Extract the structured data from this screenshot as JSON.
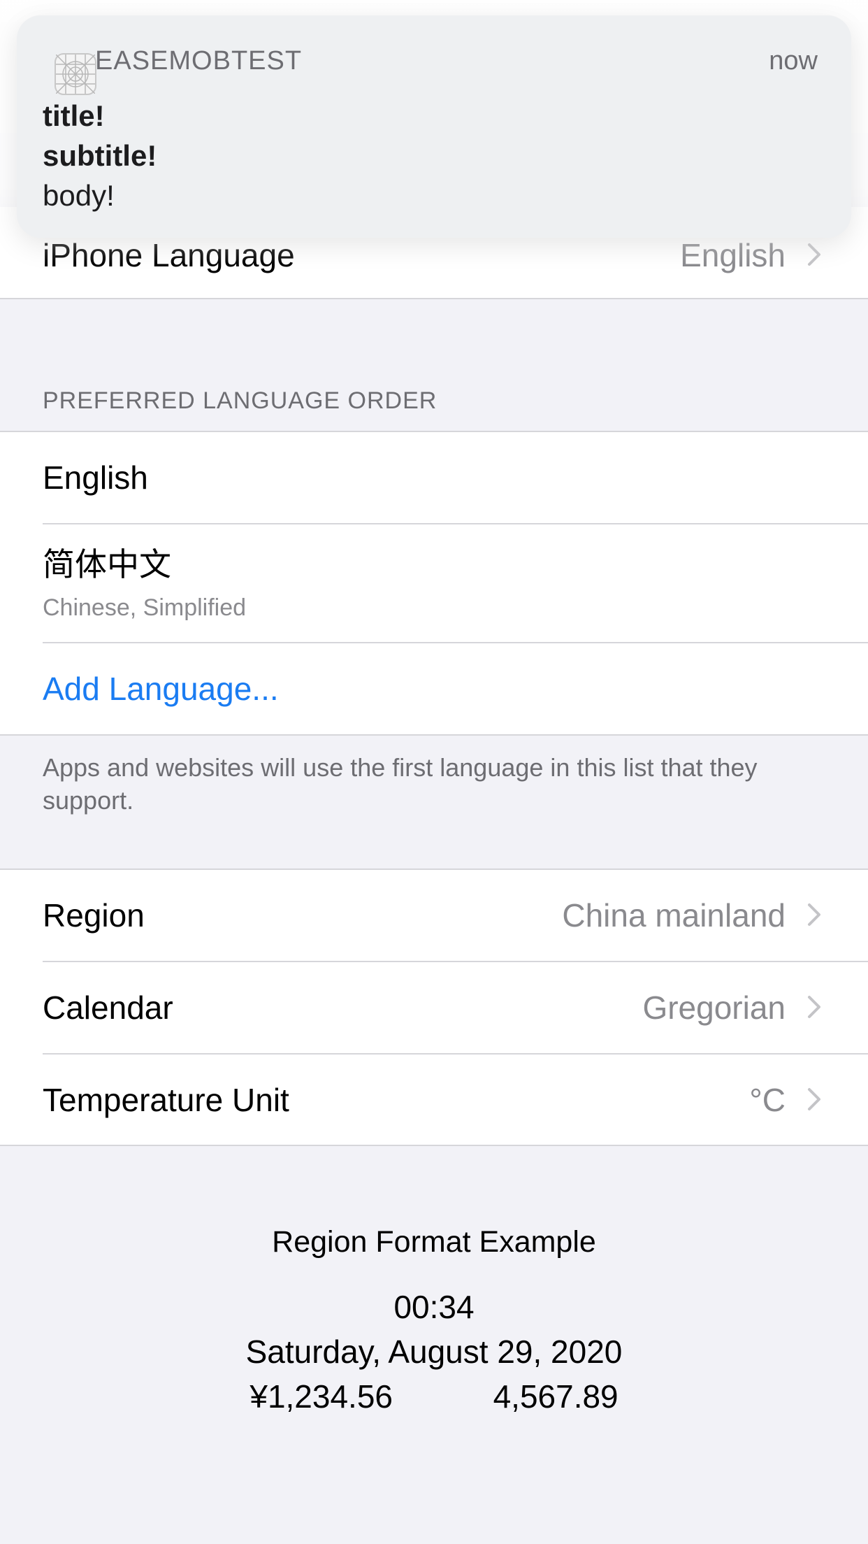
{
  "notification": {
    "app_name": "EASEMOBTEST",
    "time": "now",
    "title": "title!",
    "subtitle": "subtitle!",
    "body": "body!"
  },
  "language_row": {
    "label": "iPhone Language",
    "value": "English"
  },
  "preferred_section": {
    "header": "PREFERRED LANGUAGE ORDER",
    "languages": [
      {
        "name": "English"
      },
      {
        "name": "简体中文",
        "subtitle": "Chinese, Simplified"
      }
    ],
    "add_label": "Add Language...",
    "footer": "Apps and websites will use the first language in this list that they support."
  },
  "settings_rows": [
    {
      "label": "Region",
      "value": "China mainland"
    },
    {
      "label": "Calendar",
      "value": "Gregorian"
    },
    {
      "label": "Temperature Unit",
      "value": "°C"
    }
  ],
  "format_example": {
    "title": "Region Format Example",
    "time": "00:34",
    "date": "Saturday, August 29, 2020",
    "currency": "¥1,234.56",
    "number": "4,567.89"
  },
  "colors": {
    "background": "#f2f2f7",
    "link": "#1a7cf2",
    "secondary": "#8a8a8e"
  }
}
